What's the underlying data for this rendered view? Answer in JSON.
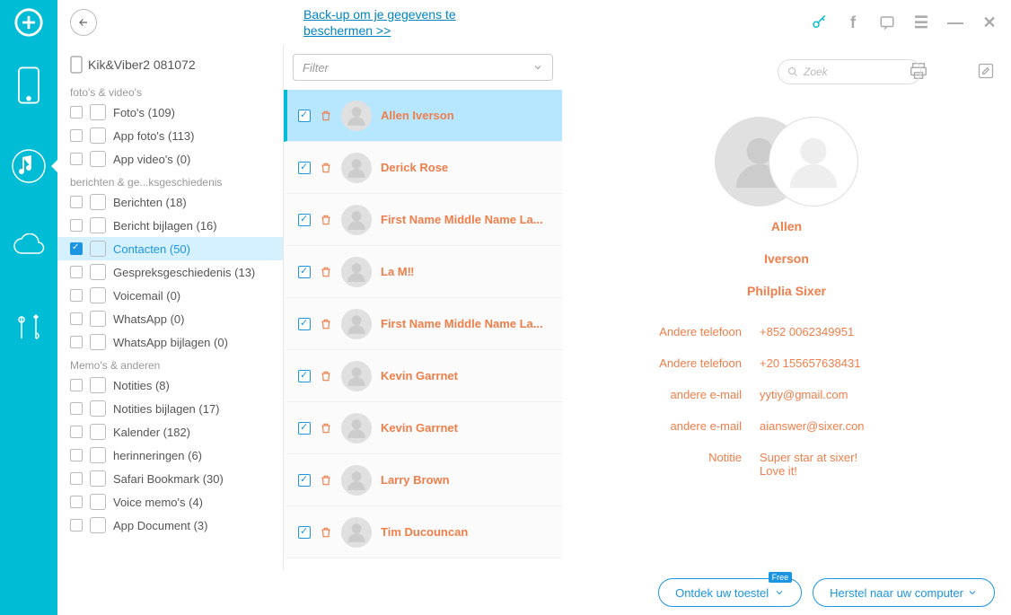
{
  "topbar": {
    "banner_line1": "Back-up om je gegevens te",
    "banner_line2": "beschermen >>"
  },
  "sidebar": {
    "device": "Kik&Viber2 081072",
    "sections": [
      {
        "title": "foto's & video's",
        "items": [
          {
            "label": "Foto's (109)"
          },
          {
            "label": "App foto's (113)"
          },
          {
            "label": "App video's (0)"
          }
        ]
      },
      {
        "title": "berichten & ge...ksgeschiedenis",
        "items": [
          {
            "label": "Berichten (18)"
          },
          {
            "label": "Bericht bijlagen (16)"
          },
          {
            "label": "Contacten (50)",
            "active": true
          },
          {
            "label": "Gespreksgeschiedenis (13)"
          },
          {
            "label": "Voicemail (0)"
          },
          {
            "label": "WhatsApp (0)"
          },
          {
            "label": "WhatsApp bijlagen (0)"
          }
        ]
      },
      {
        "title": "Memo's & anderen",
        "items": [
          {
            "label": "Notities (8)"
          },
          {
            "label": "Notities bijlagen (17)"
          },
          {
            "label": "Kalender (182)"
          },
          {
            "label": "herinneringen (6)"
          },
          {
            "label": "Safari Bookmark (30)"
          },
          {
            "label": "Voice memo's (4)"
          },
          {
            "label": "App Document (3)"
          }
        ]
      }
    ]
  },
  "mid": {
    "filter_label": "Filter",
    "contacts": [
      {
        "name": "Allen  Iverson",
        "selected": true
      },
      {
        "name": "Derick Rose"
      },
      {
        "name": "First Name Middle Name La..."
      },
      {
        "name": "La M‼"
      },
      {
        "name": "First Name Middle Name La..."
      },
      {
        "name": "Kevin Garrnet"
      },
      {
        "name": "Kevin Garrnet"
      },
      {
        "name": "Larry Brown"
      },
      {
        "name": "Tim  Ducouncan"
      }
    ]
  },
  "search_placeholder": "Zoek",
  "detail": {
    "name1": "Allen",
    "name2": "Iverson",
    "name3": "Philplia Sixer",
    "fields": [
      {
        "lbl": "Andere telefoon",
        "val": "+852 0062349951"
      },
      {
        "lbl": "Andere telefoon",
        "val": "+20 155657638431"
      },
      {
        "lbl": "andere e-mail",
        "val": "yytiy@gmail.com"
      },
      {
        "lbl": "andere e-mail",
        "val": "aianswer@sixer.con"
      },
      {
        "lbl": "Notitie",
        "val": "Super star at sixer!\nLove it!"
      }
    ]
  },
  "buttons": {
    "discover": "Ontdek uw toestel",
    "discover_badge": "Free",
    "restore": "Herstel naar uw computer"
  }
}
